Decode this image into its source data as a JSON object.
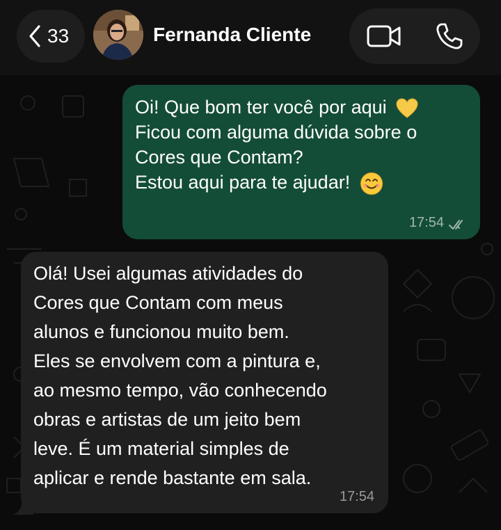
{
  "header": {
    "back_count": "33",
    "contact_name": "Fernanda Cliente"
  },
  "messages": [
    {
      "direction": "outgoing",
      "lines": [
        "Oi! Que bom ter você por aqui",
        "Ficou com alguma dúvida sobre o",
        "Cores que Contam?",
        "Estou aqui para te ajudar!"
      ],
      "emojis": [
        "yellow-heart-icon",
        "smiling-face-icon"
      ],
      "time": "17:54",
      "status": "read-double-check"
    },
    {
      "direction": "incoming",
      "lines": [
        "Olá! Usei algumas atividades do",
        "Cores que Contam com meus",
        "alunos e funcionou muito bem.",
        "Eles se envolvem com a pintura e,",
        "ao mesmo tempo, vão conhecendo",
        "obras e artistas de um jeito bem",
        "leve. É um material simples de",
        "aplicar e rende bastante em sala."
      ],
      "time": "17:54"
    }
  ],
  "colors": {
    "outgoing_bubble": "#144d37",
    "incoming_bubble": "#202020",
    "background": "#0b0b0b"
  }
}
